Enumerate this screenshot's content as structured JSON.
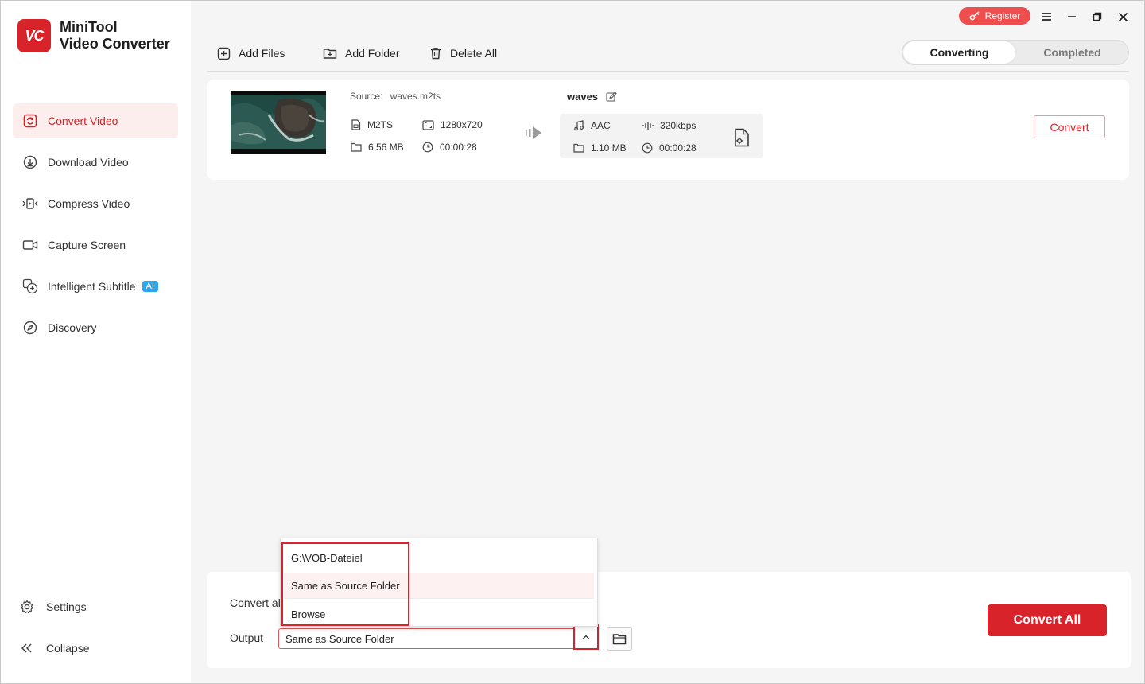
{
  "app": {
    "name_line1": "MiniTool",
    "name_line2": "Video Converter",
    "logo_text": "VC",
    "accent": "#d8232a"
  },
  "sidebar": {
    "items": [
      {
        "label": "Convert Video",
        "icon": "convert-icon",
        "active": true
      },
      {
        "label": "Download Video",
        "icon": "download-icon"
      },
      {
        "label": "Compress Video",
        "icon": "compress-icon"
      },
      {
        "label": "Capture Screen",
        "icon": "camera-icon"
      },
      {
        "label": "Intelligent Subtitle",
        "icon": "subtitle-icon",
        "badge": "AI"
      },
      {
        "label": "Discovery",
        "icon": "compass-icon"
      }
    ],
    "settings_label": "Settings",
    "collapse_label": "Collapse"
  },
  "window": {
    "register_label": "Register"
  },
  "toolbar": {
    "add_files": "Add Files",
    "add_folder": "Add Folder",
    "delete_all": "Delete All"
  },
  "tabs": {
    "converting": "Converting",
    "completed": "Completed"
  },
  "file": {
    "source_label": "Source:",
    "source_name": "waves.m2ts",
    "format": "M2TS",
    "resolution": "1280x720",
    "size": "6.56 MB",
    "duration": "00:00:28",
    "target_name": "waves",
    "target_format": "AAC",
    "target_bitrate": "320kbps",
    "target_size": "1.10 MB",
    "target_duration": "00:00:28",
    "convert_label": "Convert"
  },
  "bottom": {
    "convert_all_label": "Convert al",
    "output_label": "Output",
    "output_value": "Same as Source Folder",
    "convert_all_button": "Convert All"
  },
  "dropdown": {
    "options": [
      "G:\\VOB-Dateiel",
      "Same as Source Folder",
      "Browse"
    ]
  }
}
